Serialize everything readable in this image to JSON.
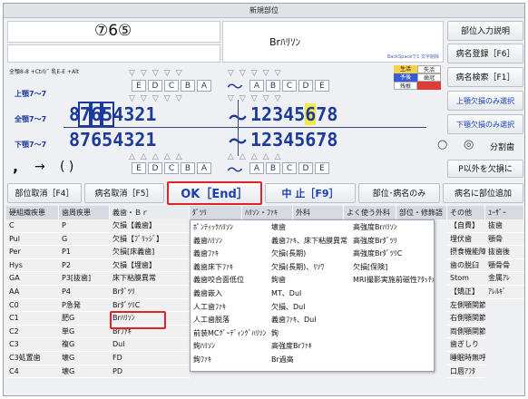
{
  "window": {
    "title": "新規部位"
  },
  "top": {
    "display_numbers": "⑦6⑤",
    "part_name": "Brﾊﾘｿﾝ",
    "hint": "BackSpaceで1 文字削除",
    "shortcut_hint": "全顎8-8 +Ctrl/¯ 乳E-E +Alt"
  },
  "right_buttons": {
    "part_input_help": "部位入力説明",
    "disease_register": "病名登録［F6］",
    "disease_search": "病名検索［F1］",
    "upper_select_missing": "上顎欠損のみ選択",
    "lower_select_missing": "下顎欠損のみ選択",
    "split_teeth": "分割歯",
    "p_missing": "P以外を欠損に"
  },
  "jaw_labels": {
    "upper": "上顎7～7",
    "all": "全顎7～7",
    "lower": "下顎7～7"
  },
  "teeth": {
    "upper_letters_left": [
      "E",
      "D",
      "C",
      "B",
      "A"
    ],
    "upper_letters_right": [
      "A",
      "B",
      "C",
      "D",
      "E"
    ],
    "upper_left": [
      "8",
      "7",
      "6",
      "5",
      "4",
      "3",
      "2",
      "1"
    ],
    "upper_right": [
      "1",
      "2",
      "3",
      "4",
      "5",
      "6",
      "7",
      "8"
    ],
    "lower_left": [
      "8",
      "7",
      "6",
      "5",
      "4",
      "3",
      "2",
      "1"
    ],
    "lower_right": [
      "1",
      "2",
      "3",
      "4",
      "5",
      "6",
      "7",
      "8"
    ],
    "tilde": "～"
  },
  "legend": [
    "生活",
    "失活",
    "予後",
    "歯冠",
    "残根"
  ],
  "symbols": {
    "comma": ",",
    "arrow": "→",
    "paren": "( )"
  },
  "radio": {
    "a": "○",
    "b": "◎"
  },
  "action_bar": {
    "cancel_part": "部位取消［F4］",
    "cancel_disease": "病名取消［F5］",
    "ok": "OK［End］",
    "abort": "中 止［F9］",
    "part_disease_only": "部位･病名のみ",
    "add_part_to_disease": "病名に部位追加"
  },
  "columns": {
    "headers": [
      "硬組織疾患",
      "歯周疾患",
      "義歯・Ｂｒ",
      "ﾀﾞﾂﾘ",
      "ﾊﾘｿﾝ・ﾌｧｷ",
      "外科",
      "よく使う外科",
      "部位・修飾語",
      "その他",
      "ﾕｰｻﾞｰ"
    ],
    "col1": [
      "C",
      "Pul",
      "Per",
      "Hys",
      "GA",
      "AA",
      "C0",
      "C1",
      "C2",
      "C3",
      "C3処置歯",
      "C4"
    ],
    "col2": [
      "P",
      "G",
      "P1",
      "P2",
      "P3[抜歯]",
      "P4",
      "P急発",
      "肥G",
      "単G",
      "複G",
      "壊G",
      "壊G"
    ],
    "col3": [
      "欠損【義歯】",
      "欠損【ﾌﾞﾘｯｼﾞ】",
      "欠損[床義歯]",
      "欠損【埋歯】",
      "床下粘膜異常",
      "Brﾀﾞﾂﾘ",
      "BrﾀﾞﾂﾘC",
      "Brﾊﾘｿﾝ",
      "Brﾌｧｷ",
      "Dul",
      "FD",
      "PD"
    ],
    "col4": [
      "ﾎﾟﾝﾃｨｯｸﾊﾘｿﾝ",
      "義歯ﾊﾘｿﾝ",
      "義歯ﾌｧｷ",
      "義歯床下ﾌｧｷ",
      "義歯咬合面低位",
      "義歯嵌入",
      "人工歯ﾌｧｷ",
      "人工歯脱落",
      "前装MCｸﾞｰﾃﾞｨﾝｸﾞﾊﾘｿﾝ",
      "鉤ﾊﾘｿﾝ",
      "鉤ﾌｧｷ",
      ""
    ],
    "col5": [
      "壊歯",
      "義歯ﾌｧｷ、床下粘膜異常",
      "欠損(長期)",
      "欠損(長期)、ﾘｿﾜ",
      "鉤歯",
      "MT、Dul",
      "欠損、Dul",
      "義歯ﾌｧｷ、Dul",
      "鉤",
      "高強度Brﾌｧｷ",
      "Br過高",
      ""
    ],
    "col6": [
      "高強度Brﾊﾘｿﾝ",
      "高強度Brﾀﾞﾂﾘ",
      "高強度BrﾀﾞﾂﾘC",
      "欠損[保険]",
      "MRI撮影実施前磁性ｱﾀｯﾁﾒﾝﾄ",
      "",
      "",
      "",
      "",
      "",
      "",
      ""
    ],
    "col9": [
      "【自費】",
      "埋伏歯",
      "摂食機能障害",
      "歯の脱臼",
      "Stom",
      "【矯正】",
      "左側顎関節症",
      "右側顎関節症",
      "両側顎関節症",
      "歯ぎしり",
      "睡眠時無呼吸",
      "口唇ｱﾌﾀ"
    ],
    "col10": [
      "抜歯",
      "顎骨",
      "抜歯後",
      "顎骨骨",
      "金属ｱﾚ",
      "ｱﾚﾙｷﾞ",
      "",
      "",
      "",
      "",
      "",
      ""
    ]
  },
  "colors": {
    "accent_red": "#e0222a",
    "tooth_blue": "#1c3a9a",
    "highlight_yellow": "#f7e84a"
  }
}
